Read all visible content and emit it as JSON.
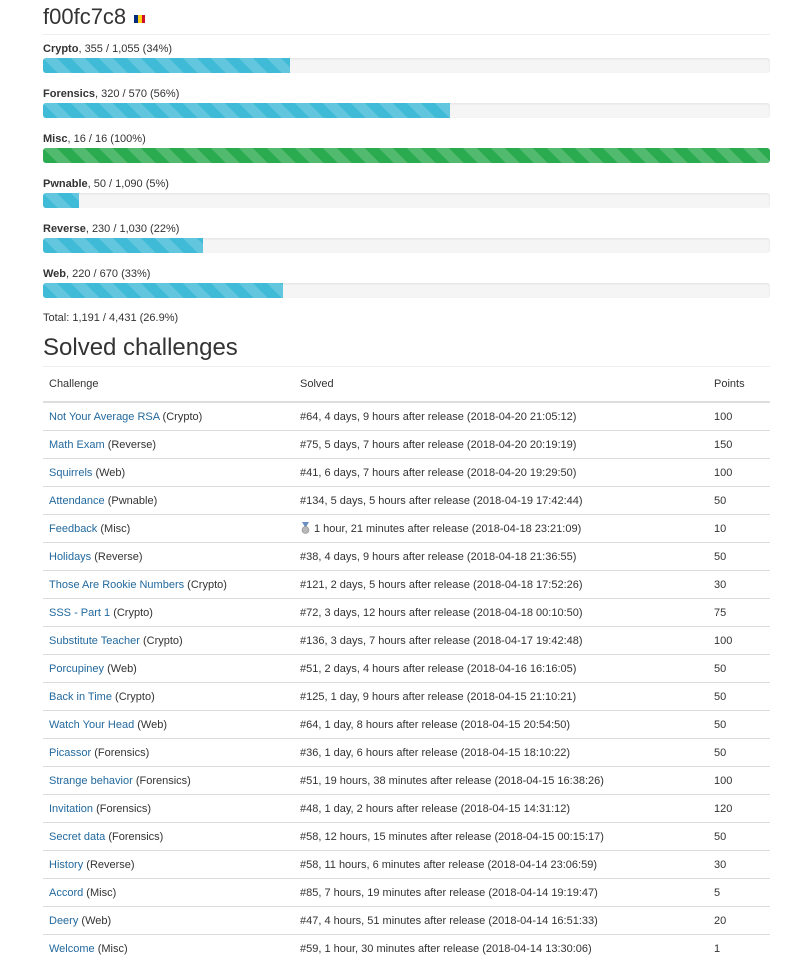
{
  "profile": {
    "username": "f00fc7c8",
    "flag_colors": [
      "#002b7f",
      "#fcd116",
      "#ce1126"
    ]
  },
  "colors": {
    "progress_info": "#3fbbd7",
    "progress_success": "#2bab4f",
    "link": "#23699e"
  },
  "categories": [
    {
      "name": "Crypto",
      "stats": ", 355 / 1,055 (34%)",
      "progress": 34,
      "status": "info"
    },
    {
      "name": "Forensics",
      "stats": ", 320 / 570 (56%)",
      "progress": 56,
      "status": "info"
    },
    {
      "name": "Misc",
      "stats": ", 16 / 16 (100%)",
      "progress": 100,
      "status": "success"
    },
    {
      "name": "Pwnable",
      "stats": ", 50 / 1,090 (5%)",
      "progress": 5,
      "status": "info"
    },
    {
      "name": "Reverse",
      "stats": ", 230 / 1,030 (22%)",
      "progress": 22,
      "status": "info"
    },
    {
      "name": "Web",
      "stats": ", 220 / 670 (33%)",
      "progress": 33,
      "status": "info"
    }
  ],
  "total": "Total: 1,191 / 4,431 (26.9%)",
  "solved": {
    "title": "Solved challenges",
    "headers": {
      "challenge": "Challenge",
      "solved": "Solved",
      "points": "Points"
    },
    "rows": [
      {
        "name": "Not Your Average RSA",
        "category": " (Crypto)",
        "solved": "#64, 4 days, 9 hours after release (2018-04-20 21:05:12)",
        "points": "100",
        "medal": false
      },
      {
        "name": "Math Exam",
        "category": " (Reverse)",
        "solved": "#75, 5 days, 7 hours after release (2018-04-20 20:19:19)",
        "points": "150",
        "medal": false
      },
      {
        "name": "Squirrels",
        "category": " (Web)",
        "solved": "#41, 6 days, 7 hours after release (2018-04-20 19:29:50)",
        "points": "100",
        "medal": false
      },
      {
        "name": "Attendance",
        "category": " (Pwnable)",
        "solved": "#134, 5 days, 5 hours after release (2018-04-19 17:42:44)",
        "points": "50",
        "medal": false
      },
      {
        "name": "Feedback",
        "category": " (Misc)",
        "solved": "1 hour, 21 minutes after release (2018-04-18 23:21:09)",
        "points": "10",
        "medal": true
      },
      {
        "name": "Holidays",
        "category": " (Reverse)",
        "solved": "#38, 4 days, 9 hours after release (2018-04-18 21:36:55)",
        "points": "50",
        "medal": false
      },
      {
        "name": "Those Are Rookie Numbers",
        "category": " (Crypto)",
        "solved": "#121, 2 days, 5 hours after release (2018-04-18 17:52:26)",
        "points": "30",
        "medal": false
      },
      {
        "name": "SSS - Part 1",
        "category": " (Crypto)",
        "solved": "#72, 3 days, 12 hours after release (2018-04-18 00:10:50)",
        "points": "75",
        "medal": false
      },
      {
        "name": "Substitute Teacher",
        "category": " (Crypto)",
        "solved": "#136, 3 days, 7 hours after release (2018-04-17 19:42:48)",
        "points": "100",
        "medal": false
      },
      {
        "name": "Porcupiney",
        "category": " (Web)",
        "solved": "#51, 2 days, 4 hours after release (2018-04-16 16:16:05)",
        "points": "50",
        "medal": false
      },
      {
        "name": "Back in Time",
        "category": " (Crypto)",
        "solved": "#125, 1 day, 9 hours after release (2018-04-15 21:10:21)",
        "points": "50",
        "medal": false
      },
      {
        "name": "Watch Your Head",
        "category": " (Web)",
        "solved": "#64, 1 day, 8 hours after release (2018-04-15 20:54:50)",
        "points": "50",
        "medal": false
      },
      {
        "name": "Picassor",
        "category": " (Forensics)",
        "solved": "#36, 1 day, 6 hours after release (2018-04-15 18:10:22)",
        "points": "50",
        "medal": false
      },
      {
        "name": "Strange behavior",
        "category": " (Forensics)",
        "solved": "#51, 19 hours, 38 minutes after release (2018-04-15 16:38:26)",
        "points": "100",
        "medal": false
      },
      {
        "name": "Invitation",
        "category": " (Forensics)",
        "solved": "#48, 1 day, 2 hours after release (2018-04-15 14:31:12)",
        "points": "120",
        "medal": false
      },
      {
        "name": "Secret data",
        "category": " (Forensics)",
        "solved": "#58, 12 hours, 15 minutes after release (2018-04-15 00:15:17)",
        "points": "50",
        "medal": false
      },
      {
        "name": "History",
        "category": " (Reverse)",
        "solved": "#58, 11 hours, 6 minutes after release (2018-04-14 23:06:59)",
        "points": "30",
        "medal": false
      },
      {
        "name": "Accord",
        "category": " (Misc)",
        "solved": "#85, 7 hours, 19 minutes after release (2018-04-14 19:19:47)",
        "points": "5",
        "medal": false
      },
      {
        "name": "Deery",
        "category": " (Web)",
        "solved": "#47, 4 hours, 51 minutes after release (2018-04-14 16:51:33)",
        "points": "20",
        "medal": false
      },
      {
        "name": "Welcome",
        "category": " (Misc)",
        "solved": "#59, 1 hour, 30 minutes after release (2018-04-14 13:30:06)",
        "points": "1",
        "medal": false
      }
    ]
  }
}
